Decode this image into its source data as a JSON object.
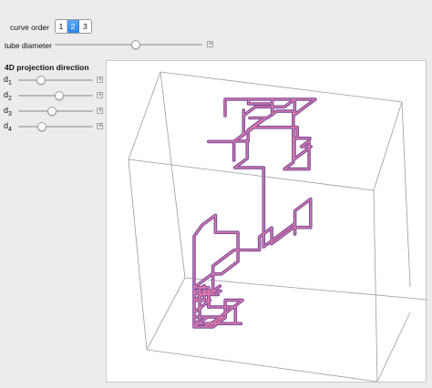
{
  "controls": {
    "curve_order": {
      "label": "curve order",
      "options": [
        "1",
        "2",
        "3"
      ],
      "selected": "2"
    },
    "tube_diameter": {
      "label": "tube diameter",
      "value": 0.55
    },
    "projection": {
      "title": "4D projection direction",
      "sliders": [
        {
          "label": "d",
          "sub": "1",
          "value": 0.3
        },
        {
          "label": "d",
          "sub": "2",
          "value": 0.55
        },
        {
          "label": "d",
          "sub": "3",
          "value": 0.45
        },
        {
          "label": "d",
          "sub": "4",
          "value": 0.32
        }
      ]
    },
    "plus_glyph": "+"
  },
  "colors": {
    "tube_primary": "#7a4fa0",
    "tube_highlight": "#e27aa6",
    "selected_segment": "#2d86ea"
  }
}
